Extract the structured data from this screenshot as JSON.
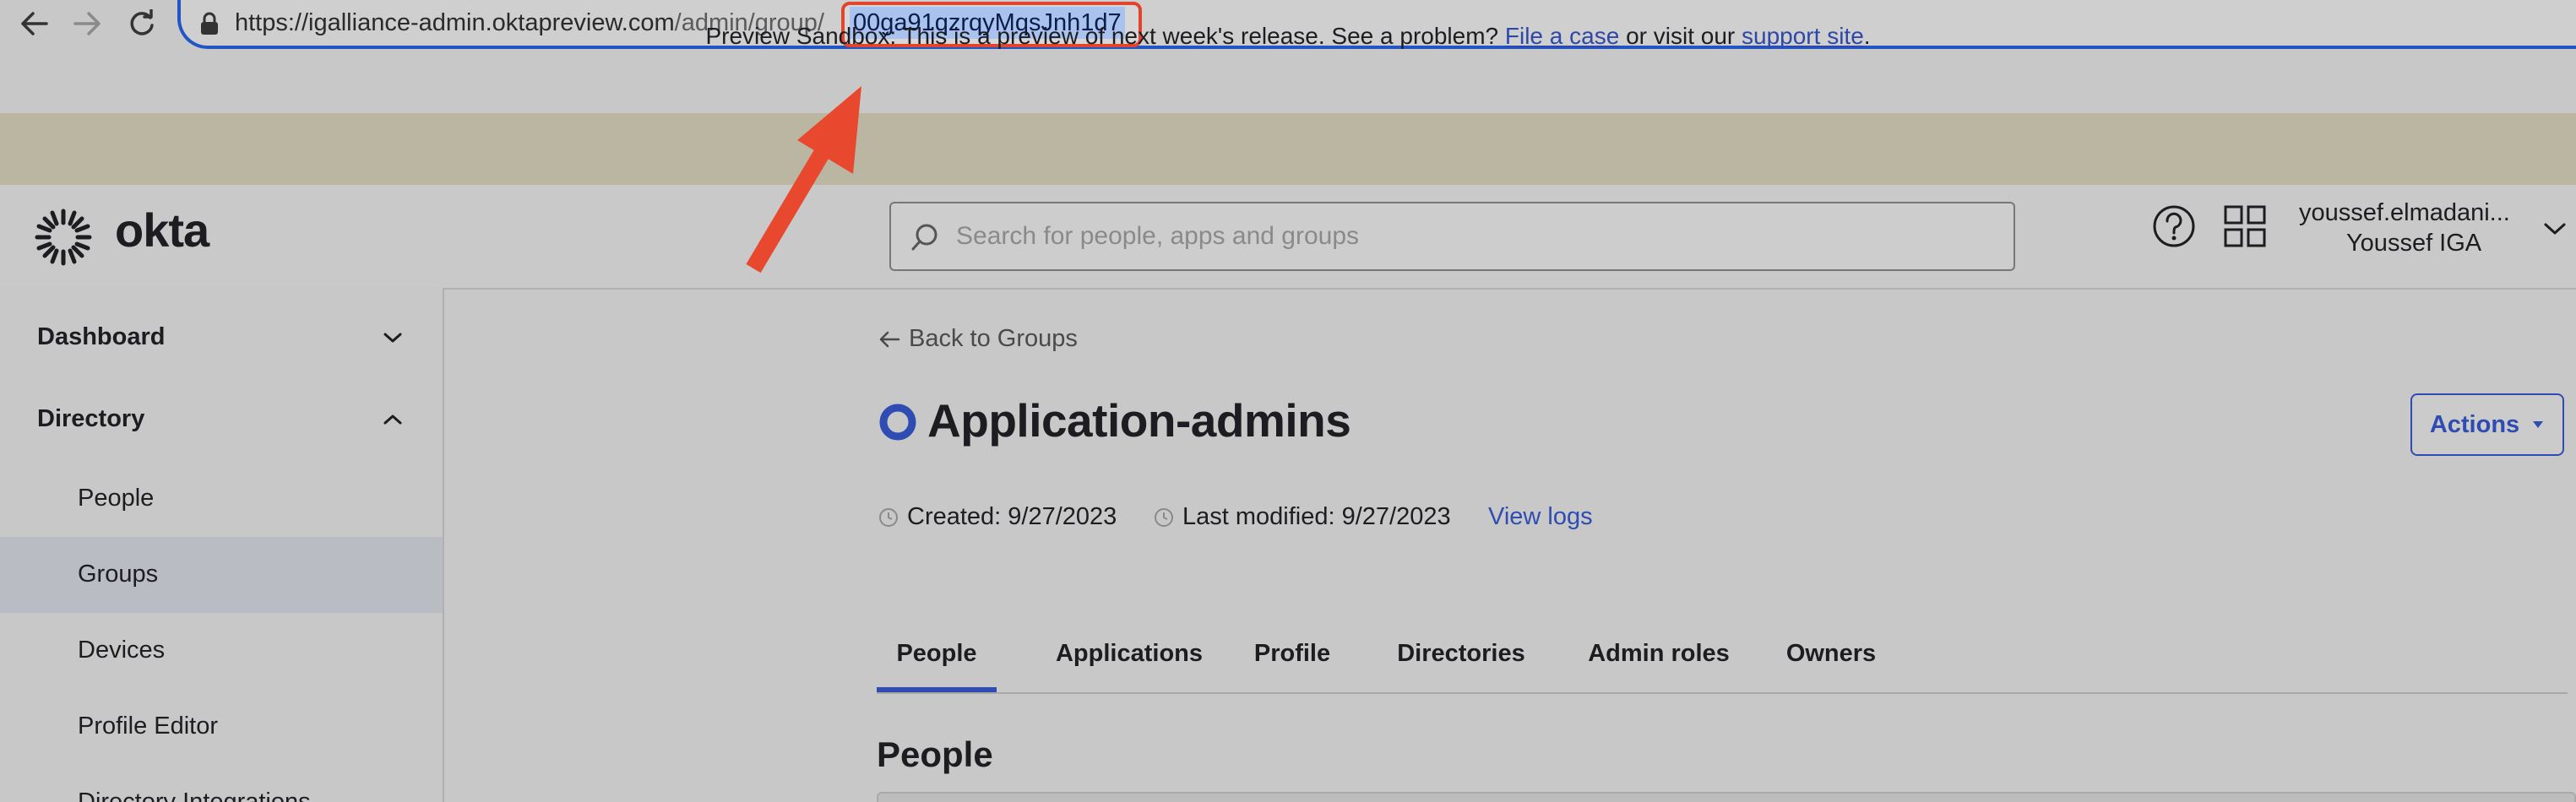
{
  "browser": {
    "url_host": "https://igalliance-admin.oktapreview.com",
    "url_path": "/admin/group/",
    "url_id": "00ga91qzrqyMqsJnh1d7"
  },
  "banner": {
    "text": "Preview Sandbox: This is a preview of next week's release. See a problem?",
    "link1": "File a case",
    "middle": "or visit our",
    "link2": "support site",
    "end": "."
  },
  "header": {
    "logo": "okta",
    "search_placeholder": "Search for people, apps and groups",
    "user_name": "youssef.elmadani...",
    "user_org": "Youssef IGA"
  },
  "sidebar": {
    "dashboard": "Dashboard",
    "directory": "Directory",
    "items": [
      {
        "label": "People"
      },
      {
        "label": "Groups"
      },
      {
        "label": "Devices"
      },
      {
        "label": "Profile Editor"
      },
      {
        "label": "Directory Integrations"
      }
    ]
  },
  "main": {
    "back_link": "Back to Groups",
    "title": "Application-admins",
    "actions_label": "Actions",
    "created": "Created: 9/27/2023",
    "modified": "Last modified: 9/27/2023",
    "view_logs": "View logs",
    "tabs": [
      {
        "label": "People"
      },
      {
        "label": "Applications"
      },
      {
        "label": "Profile"
      },
      {
        "label": "Directories"
      },
      {
        "label": "Admin roles"
      },
      {
        "label": "Owners"
      }
    ],
    "section_heading": "People"
  },
  "colors": {
    "accent": "#2f4cb2",
    "annotation": "#e8482e",
    "banner_bg": "#bbb6a1",
    "highlight": "#a9c3ee"
  }
}
